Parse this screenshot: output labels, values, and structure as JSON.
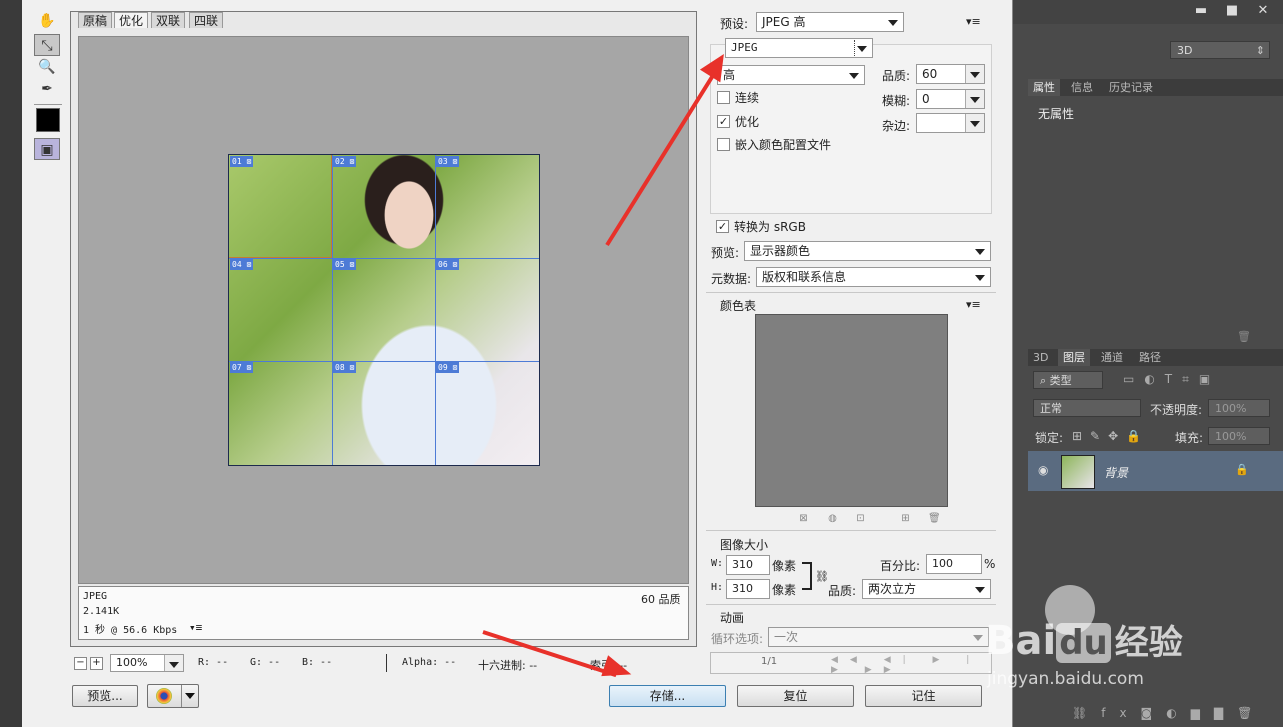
{
  "ps": {
    "workspace": "3D",
    "panel1_tabs": [
      "属性",
      "信息",
      "历史记录"
    ],
    "panel1_content": "无属性",
    "panel2_tabs": [
      "3D",
      "图层",
      "通道",
      "路径"
    ],
    "filter_type": "类型",
    "blend_mode": "正常",
    "opacity_label": "不透明度:",
    "opacity_value": "100%",
    "lock_label": "锁定:",
    "fill_label": "填充:",
    "fill_value": "100%",
    "layer_name": "背景",
    "window_min": "▬",
    "window_max": "■",
    "window_close": "✕"
  },
  "dialog": {
    "view_tabs": [
      "原稿",
      "优化",
      "双联",
      "四联"
    ],
    "slices": [
      "01",
      "02",
      "03",
      "04",
      "05",
      "06",
      "07",
      "08",
      "09"
    ],
    "info": {
      "format": "JPEG",
      "size": "2.141K",
      "time": "1 秒 @ 56.6 Kbps",
      "quality": "60 品质"
    },
    "status": {
      "zoom": "100%",
      "r": "R: --",
      "g": "G: --",
      "b": "B: --",
      "alpha": "Alpha: --",
      "hex": "十六进制: --",
      "index": "索引: --"
    },
    "buttons": {
      "preview": "预览...",
      "save": "存储...",
      "reset": "复位",
      "remember": "记住"
    },
    "settings": {
      "preset_label": "预设:",
      "preset_value": "JPEG 高",
      "format_value": "JPEG",
      "quality_level": "高",
      "quality_label": "品质:",
      "quality_value": "60",
      "blur_label": "模糊:",
      "blur_value": "0",
      "matte_label": "杂边:",
      "matte_value": "",
      "progressive_label": "连续",
      "optimized_label": "优化",
      "embed_profile_label": "嵌入颜色配置文件",
      "convert_srgb_label": "转换为 sRGB",
      "preview_label": "预览:",
      "preview_value": "显示器颜色",
      "metadata_label": "元数据:",
      "metadata_value": "版权和联系信息",
      "color_table_label": "颜色表",
      "image_size_label": "图像大小",
      "width_label": "W:",
      "width_value": "310",
      "height_label": "H:",
      "height_value": "310",
      "pixels_unit": "像素",
      "percent_label": "百分比:",
      "percent_value": "100",
      "percent_unit": "%",
      "resample_label": "品质:",
      "resample_value": "两次立方",
      "animation_label": "动画",
      "loop_label": "循环选项:",
      "loop_value": "一次",
      "frame_counter": "1/1"
    }
  },
  "watermark": {
    "brand": "Bai",
    "brand2": "du",
    "suffix": "经验",
    "url": "jingyan.baidu.com"
  },
  "colors": {
    "arrow": "#e8312a",
    "slice_blue": "#4d7bd6"
  }
}
